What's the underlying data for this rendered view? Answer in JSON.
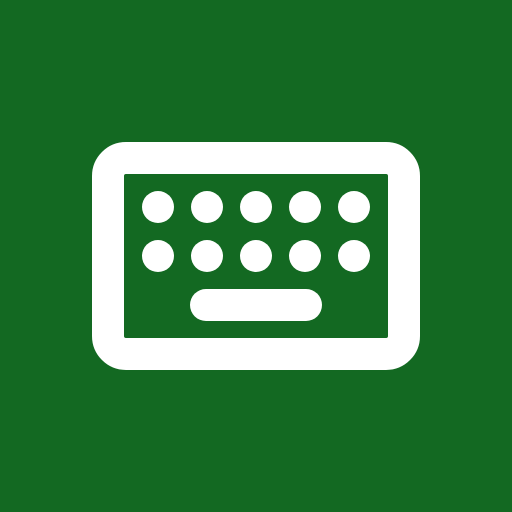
{
  "app_icon": {
    "icon": "keyboard-icon",
    "background_color": "#136922",
    "foreground_color": "#ffffff",
    "key_rows": [
      5,
      5
    ],
    "has_spacebar": true
  }
}
